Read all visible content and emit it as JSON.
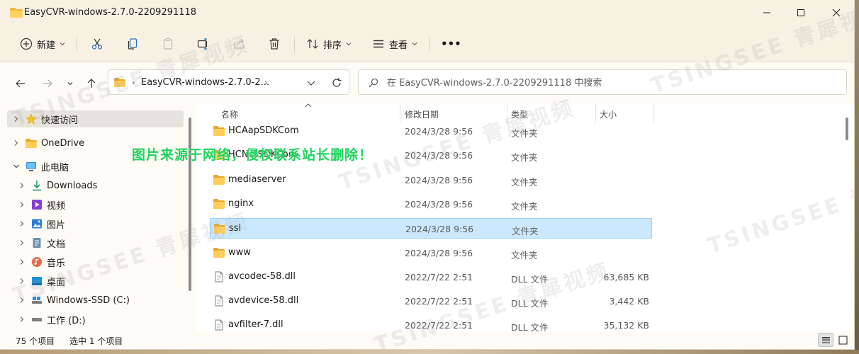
{
  "window": {
    "title": "EasyCVR-windows-2.7.0-2209291118",
    "controls": [
      "minimize",
      "maximize",
      "close"
    ]
  },
  "commandbar": {
    "new_label": "新建",
    "sort_label": "排序",
    "view_label": "查看",
    "more_label": "•••"
  },
  "navbar": {
    "address_path": "EasyCVR-windows-2.7.0-2...",
    "search_placeholder": "在 EasyCVR-windows-2.7.0-2209291118 中搜索"
  },
  "sidebar": {
    "items": [
      {
        "label": "快速访问",
        "icon": "star-icon"
      },
      {
        "label": "OneDrive",
        "icon": "folder-icon"
      },
      {
        "label": "此电脑",
        "icon": "computer-icon"
      },
      {
        "label": "Downloads",
        "icon": "download-icon"
      },
      {
        "label": "视频",
        "icon": "video-icon"
      },
      {
        "label": "图片",
        "icon": "pictures-icon"
      },
      {
        "label": "文档",
        "icon": "documents-icon"
      },
      {
        "label": "音乐",
        "icon": "music-icon"
      },
      {
        "label": "桌面",
        "icon": "desktop-icon"
      },
      {
        "label": "Windows-SSD (C:)",
        "icon": "drive-c-icon"
      },
      {
        "label": "工作 (D:)",
        "icon": "drive-d-icon"
      }
    ]
  },
  "columns": {
    "name": "名称",
    "date": "修改日期",
    "type": "类型",
    "size": "大小"
  },
  "files": [
    {
      "name": "HCAapSDKCom",
      "date": "2024/3/28 9:56",
      "type": "文件夹",
      "size": "",
      "kind": "folder"
    },
    {
      "name": "HCNetSDKCom",
      "date": "2024/3/28 9:56",
      "type": "文件夹",
      "size": "",
      "kind": "folder"
    },
    {
      "name": "mediaserver",
      "date": "2024/3/28 9:56",
      "type": "文件夹",
      "size": "",
      "kind": "folder"
    },
    {
      "name": "nginx",
      "date": "2024/3/28 9:56",
      "type": "文件夹",
      "size": "",
      "kind": "folder"
    },
    {
      "name": "ssl",
      "date": "2024/3/28 9:56",
      "type": "文件夹",
      "size": "",
      "kind": "folder",
      "selected": true
    },
    {
      "name": "www",
      "date": "2024/3/28 9:56",
      "type": "文件夹",
      "size": "",
      "kind": "folder"
    },
    {
      "name": "avcodec-58.dll",
      "date": "2022/7/22 2:51",
      "type": "DLL 文件",
      "size": "63,685 KB",
      "kind": "file"
    },
    {
      "name": "avdevice-58.dll",
      "date": "2022/7/22 2:51",
      "type": "DLL 文件",
      "size": "3,442 KB",
      "kind": "file"
    },
    {
      "name": "avfilter-7.dll",
      "date": "2022/7/22 2:51",
      "type": "DLL 文件",
      "size": "35,132 KB",
      "kind": "file"
    }
  ],
  "statusbar": {
    "count": "75 个项目",
    "selection": "选中 1 个项目"
  },
  "overlay_notice": "图片来源于网络，侵权联系站长删除！",
  "watermark_text": "TSINGSEE 青犀视频",
  "colors": {
    "accent": "#0067c0",
    "selection": "#cce8ff",
    "folder": "#f5c242",
    "notice": "#1fd35c"
  }
}
